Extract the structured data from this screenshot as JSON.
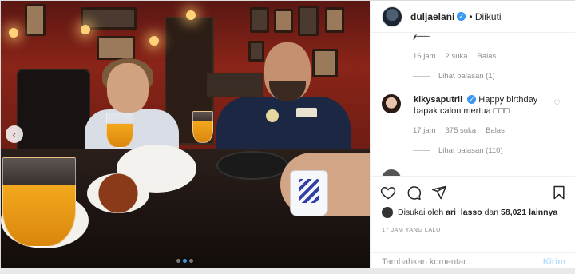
{
  "post": {
    "author": "duljaelani",
    "follow_status": "• Diikuti"
  },
  "comments": [
    {
      "meta": {
        "time": "16 jam",
        "likes": "2 suka",
        "reply": "Balas"
      },
      "view_replies": "Lihat balasan (1)"
    },
    {
      "username": "kikysaputrii",
      "text": "Happy birthday bapak calon mertua □□□",
      "meta": {
        "time": "17 jam",
        "likes": "375 suka",
        "reply": "Balas"
      },
      "view_replies": "Lihat balasan (110)"
    }
  ],
  "actions": {
    "liked_prefix": "Disukai oleh",
    "liked_user": "ari_lasso",
    "liked_join": "dan",
    "liked_count": "58,021 lainnya",
    "timestamp": "17 JAM YANG LALU"
  },
  "compose": {
    "placeholder": "Tambahkan komentar...",
    "send_label": "Kirim"
  },
  "carousel": {
    "slide_count": 3,
    "active_slide": 2
  },
  "colors": {
    "accent": "#3897f0",
    "muted_text": "#8e8e8e",
    "send_disabled": "#b2dffc"
  },
  "icons": [
    "heart-icon",
    "comment-icon",
    "share-icon",
    "bookmark-icon",
    "verified-icon",
    "chevron-left-icon"
  ]
}
